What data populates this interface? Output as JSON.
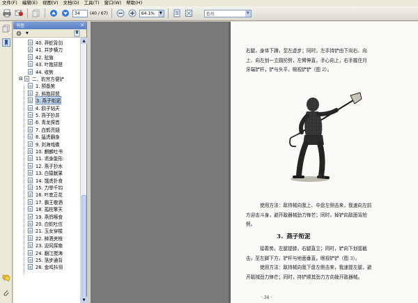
{
  "menu": [
    "文件(F)",
    "编辑(E)",
    "视图(V)",
    "文档(D)",
    "工具(T)",
    "窗口(W)",
    "帮助(H)"
  ],
  "toolbar": {
    "page_value": "34",
    "page_total": "(40 / 67)",
    "zoom": "64.1%",
    "search_placeholder": "查找"
  },
  "bookmarks": {
    "title": "书签",
    "items": [
      {
        "label": "40.  莽蛇背剑",
        "sel": false
      },
      {
        "label": "41.  井步横刀",
        "sel": false
      },
      {
        "label": "42.  扯旗",
        "sel": false
      },
      {
        "label": "43.  叶抱琵琶",
        "sel": false
      },
      {
        "label": "44.  收势",
        "sel": false
      },
      {
        "label": "二、豹宫方便铲",
        "sel": false
      },
      {
        "label": "1.   预备势",
        "sel": false
      },
      {
        "label": "2.   斜抱琵琶",
        "sel": false
      },
      {
        "label": "3.   燕子衔泥",
        "sel": true
      },
      {
        "label": "4.   鸥子钻天",
        "sel": false
      },
      {
        "label": "5.   燕子抄井",
        "sel": false
      },
      {
        "label": "6.   青龙探首",
        "sel": false
      },
      {
        "label": "7.   白鹤亮翅",
        "sel": false
      },
      {
        "label": "8.   猛虎翻身",
        "sel": false
      },
      {
        "label": "9.   刘海戏蟾",
        "sel": false
      },
      {
        "label": "10.  麒麟吐书",
        "sel": false
      },
      {
        "label": "11.  退身能形",
        "sel": false
      },
      {
        "label": "12.  燕子抄水",
        "sel": false
      },
      {
        "label": "13.  白猿献果",
        "sel": false
      },
      {
        "label": "14.  饿虎扑食",
        "sel": false
      },
      {
        "label": "15.  力举千钧",
        "sel": false
      },
      {
        "label": "16.  叶底正花",
        "sel": false
      },
      {
        "label": "17.  霸王敬酒",
        "sel": false
      },
      {
        "label": "18.  孤柱擎天",
        "sel": false
      },
      {
        "label": "19.  燕鸽啄食",
        "sel": false
      },
      {
        "label": "20.  白蛇吐信",
        "sel": false
      },
      {
        "label": "21.  玉女穿梭",
        "sel": false
      },
      {
        "label": "22.  醉酒夹枝",
        "sel": false
      },
      {
        "label": "23.  迎风挥扇",
        "sel": false
      },
      {
        "label": "24.  翻江搅海",
        "sel": false
      },
      {
        "label": "25.  落步通背",
        "sel": false
      },
      {
        "label": "26.  金鸡抖翎",
        "sel": false
      }
    ]
  },
  "document": {
    "lines_top": [
      "右腿，身体下蹲，至左虚步；同时，左手持铲由下向右、向",
      "上、向左划一立圆抡劈，左臂伸直，手心向上，右手握住月",
      "牙端铲杆，铲与头平，眼视铲铲（图 2）。"
    ],
    "figure_caption": "图 2",
    "lines_mid": [
      "使用方法：敌持械向我上、中盘左侧击来，我速向左前",
      "方迎击斗身，避开敌器械劲力锋芒；同时，掉铲向敌面背抢",
      "劈。"
    ],
    "section_title": "3．燕子衔泥",
    "lines_bottom": [
      "接着势。左腿提膝，右腿直立；同时，铲向下划弧截",
      "击，至左脚下方，铲杆与地面垂直，眼视铲铲（图 3）。",
      "使用方法：敌持械向我下盘左侧击来，我速提左腿，避",
      "开敌械劲力锋芒；同时，持铲顺其劲力方向拨开敌器械。"
    ],
    "page_number": "· 34 ·"
  }
}
